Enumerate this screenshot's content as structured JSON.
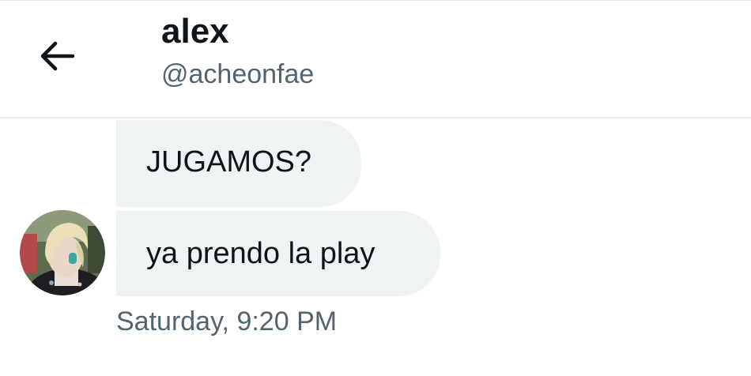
{
  "header": {
    "back_icon": "arrow-left-icon",
    "name": "alex",
    "handle": "@acheonfae"
  },
  "conversation": {
    "messages": [
      {
        "text": "JUGAMOS?"
      },
      {
        "text": "ya prendo la play"
      }
    ],
    "timestamp": "Saturday, 9:20 PM",
    "avatar_icon": "user-avatar"
  },
  "colors": {
    "text_primary": "#0f1419",
    "text_secondary": "#536471",
    "bubble_bg": "#eff3f4",
    "divider": "#e6e9ec"
  }
}
